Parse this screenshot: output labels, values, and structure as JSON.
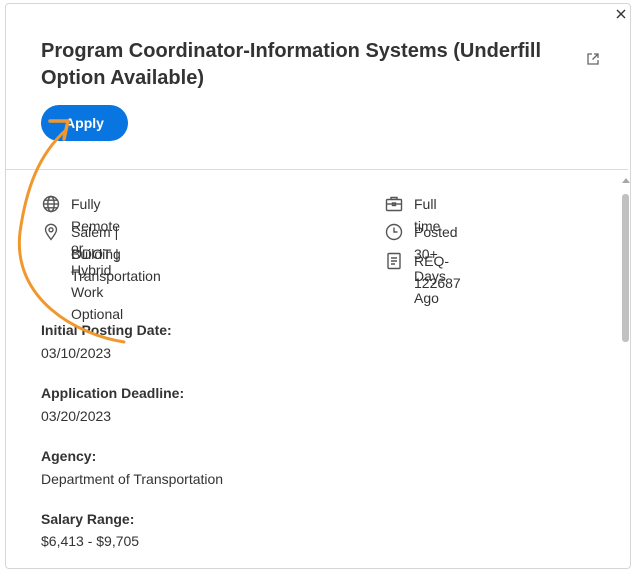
{
  "header": {
    "title": "Program Coordinator-Information Systems (Underfill Option Available)",
    "apply_label": "Apply"
  },
  "details": {
    "left": [
      {
        "icon": "globe-icon",
        "text": "Fully Remote or Hybrid Work Optional"
      },
      {
        "icon": "location-pin-icon",
        "text": "Salem | ODOT | Transportation",
        "text2": "Building"
      }
    ],
    "right": [
      {
        "icon": "briefcase-icon",
        "text": "Full time"
      },
      {
        "icon": "clock-icon",
        "text": "Posted 30+ Days Ago"
      },
      {
        "icon": "document-icon",
        "text": "REQ-122687"
      }
    ]
  },
  "fields": [
    {
      "label": "Initial Posting Date:",
      "value": "03/10/2023"
    },
    {
      "label": "Application Deadline:",
      "value": "03/20/2023"
    },
    {
      "label": "Agency:",
      "value": "Department of Transportation"
    },
    {
      "label": "Salary Range:",
      "value": "$6,413 - $9,705"
    }
  ],
  "colors": {
    "accent": "#0875e1",
    "annotation_arrow": "#f0982e"
  }
}
